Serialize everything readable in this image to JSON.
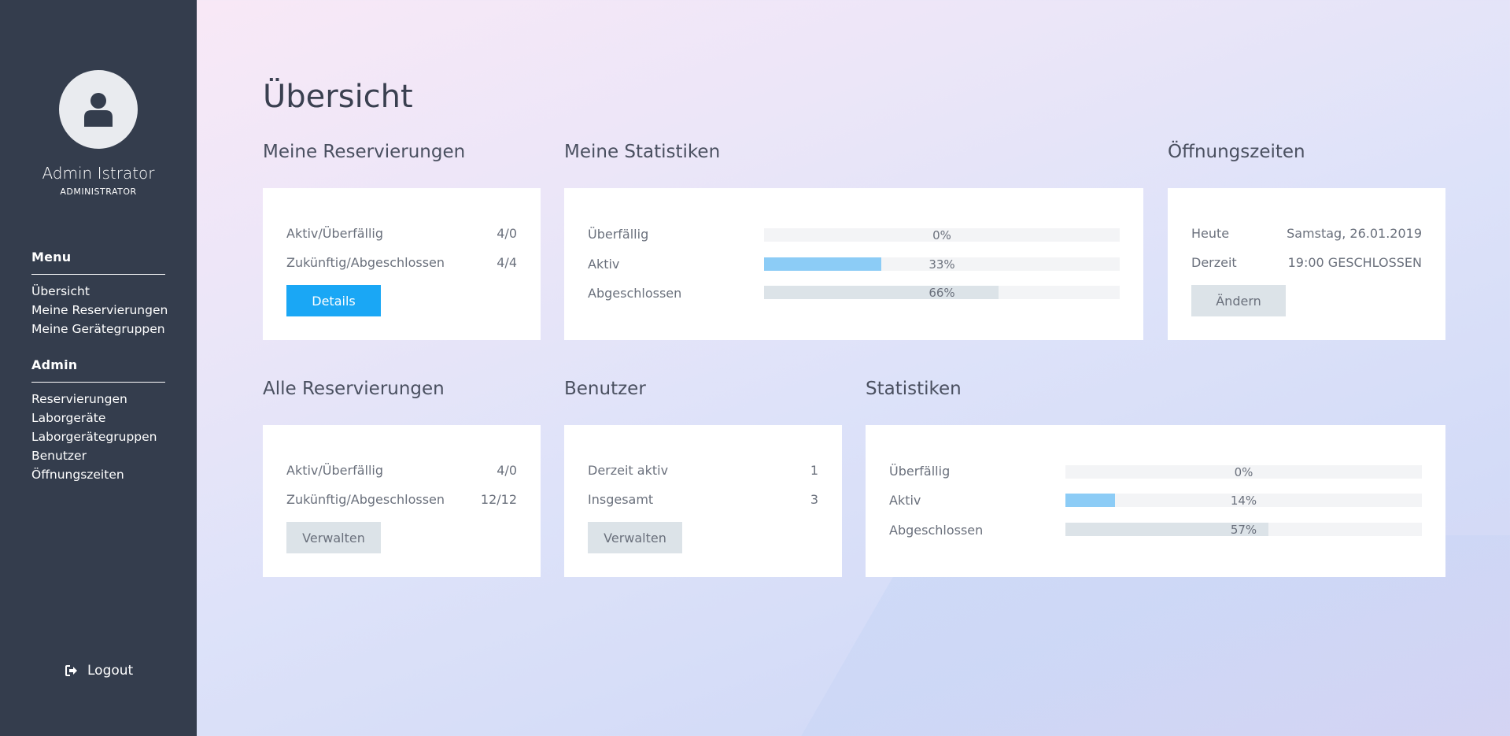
{
  "sidebar": {
    "user_name": "Admin Istrator",
    "user_role": "ADMINISTRATOR",
    "menu_heading": "Menu",
    "menu_items": [
      "Übersicht",
      "Meine Reservierungen",
      "Meine Gerätegruppen"
    ],
    "admin_heading": "Admin",
    "admin_items": [
      "Reservierungen",
      "Laborgeräte",
      "Laborgerätegruppen",
      "Benutzer",
      "Öffnungszeiten"
    ],
    "logout_label": "Logout"
  },
  "main": {
    "page_title": "Übersicht",
    "meine_reservierungen": {
      "title": "Meine Reservierungen",
      "rows": [
        {
          "label": "Aktiv/Überfällig",
          "value": "4/0"
        },
        {
          "label": "Zukünftig/Abgeschlossen",
          "value": "4/4"
        }
      ],
      "button": "Details"
    },
    "meine_statistiken": {
      "title": "Meine Statistiken",
      "bars": [
        {
          "label": "Überfällig",
          "percent": 0,
          "text": "0%",
          "color": "#8cccf6"
        },
        {
          "label": "Aktiv",
          "percent": 33,
          "text": "33%",
          "color": "#8cccf6"
        },
        {
          "label": "Abgeschlossen",
          "percent": 66,
          "text": "66%",
          "color": "#dce3e8"
        }
      ]
    },
    "oeffnungszeiten": {
      "title": "Öffnungszeiten",
      "rows": [
        {
          "label": "Heute",
          "value": "Samstag, 26.01.2019"
        },
        {
          "label": "Derzeit",
          "value": "19:00 GESCHLOSSEN"
        }
      ],
      "button": "Ändern"
    },
    "alle_reservierungen": {
      "title": "Alle Reservierungen",
      "rows": [
        {
          "label": "Aktiv/Überfällig",
          "value": "4/0"
        },
        {
          "label": "Zukünftig/Abgeschlossen",
          "value": "12/12"
        }
      ],
      "button": "Verwalten"
    },
    "benutzer": {
      "title": "Benutzer",
      "rows": [
        {
          "label": "Derzeit aktiv",
          "value": "1"
        },
        {
          "label": "Insgesamt",
          "value": "3"
        }
      ],
      "button": "Verwalten"
    },
    "statistiken": {
      "title": "Statistiken",
      "bars": [
        {
          "label": "Überfällig",
          "percent": 0,
          "text": "0%",
          "color": "#8cccf6"
        },
        {
          "label": "Aktiv",
          "percent": 14,
          "text": "14%",
          "color": "#8cccf6"
        },
        {
          "label": "Abgeschlossen",
          "percent": 57,
          "text": "57%",
          "color": "#dce3e8"
        }
      ]
    }
  },
  "icons": {
    "avatar": "user-icon",
    "logout": "sign-out-icon"
  }
}
